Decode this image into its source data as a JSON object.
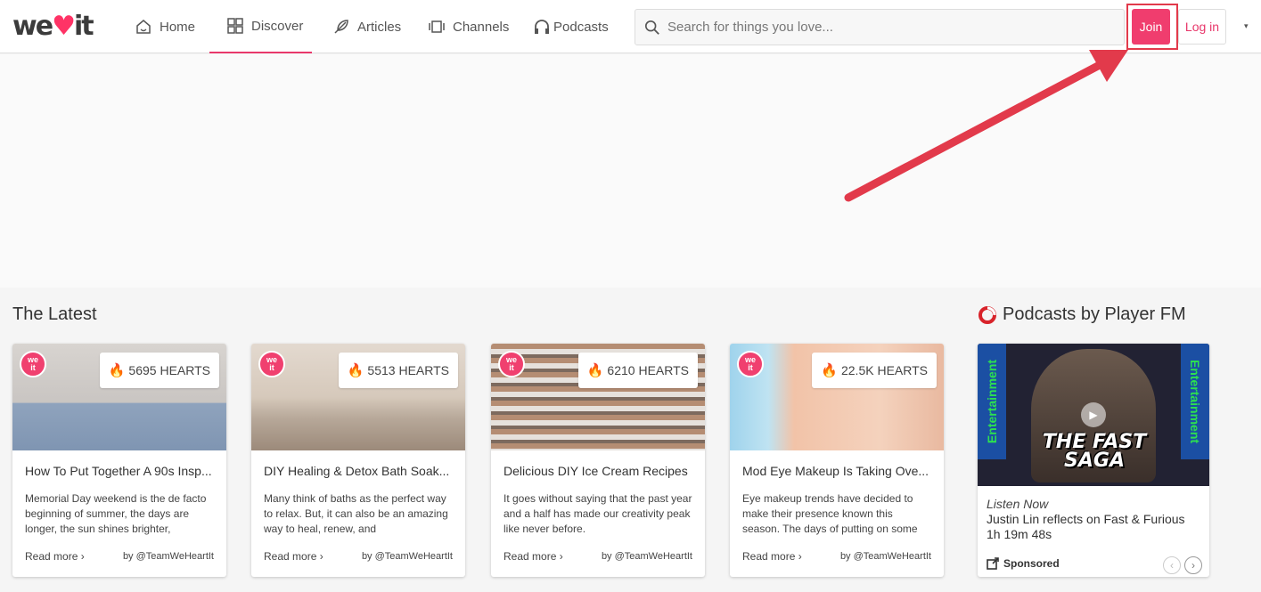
{
  "header": {
    "logo_prefix": "we",
    "logo_suffix": "it",
    "nav": [
      {
        "label": "Home",
        "icon": "home-icon"
      },
      {
        "label": "Discover",
        "icon": "grid-icon",
        "active": true
      },
      {
        "label": "Articles",
        "icon": "feather-icon"
      },
      {
        "label": "Channels",
        "icon": "channels-icon"
      },
      {
        "label": "Podcasts",
        "icon": "headphones-icon"
      }
    ],
    "search_placeholder": "Search for things you love...",
    "join_label": "Join",
    "login_label": "Log in",
    "menu_caret": "▾"
  },
  "latest": {
    "title": "The Latest",
    "cards": [
      {
        "hearts": "5695 HEARTS",
        "title": "How To Put Together A 90s Insp...",
        "text": "Memorial Day weekend is the de facto beginning of summer, the days are longer, the sun shines brighter,",
        "read_more": "Read more ›",
        "author": "by @TeamWeHeartIt",
        "img_colors": [
          "#c9c5c2",
          "#8fa3bd"
        ]
      },
      {
        "hearts": "5513 HEARTS",
        "title": "DIY Healing & Detox Bath Soak...",
        "text": "Many think of baths as the perfect way to relax. But, it can also be an amazing way to heal, renew, and",
        "read_more": "Read more ›",
        "author": "by @TeamWeHeartIt",
        "img_colors": [
          "#d6c9bb",
          "#9c8a7a"
        ]
      },
      {
        "hearts": "6210 HEARTS",
        "title": "Delicious DIY Ice Cream Recipes",
        "text": "It goes without saying that the past year and a half has made our creativity peak like never before.",
        "read_more": "Read more ›",
        "author": "by @TeamWeHeartIt",
        "img_colors": [
          "#7d6a5e",
          "#c2a58c"
        ]
      },
      {
        "hearts": "22.5K HEARTS",
        "title": "Mod Eye Makeup Is Taking Ove...",
        "text": "Eye makeup trends have decided to make their presence known this season. The days of putting on some",
        "read_more": "Read more ›",
        "author": "by @TeamWeHeartIt",
        "img_colors": [
          "#9fd3ec",
          "#f2c3a8"
        ]
      }
    ]
  },
  "podcasts": {
    "title": "Podcasts by Player FM",
    "band_text": "Entertainment",
    "caption": "THE FAST SAGA",
    "listen_now": "Listen Now",
    "episode_title": "Justin Lin reflects on Fast & Furious",
    "duration": "1h 19m 48s",
    "sponsored": "Sponsored"
  },
  "colors": {
    "brand": "#f03d6e",
    "annotation": "#e23a4b"
  }
}
